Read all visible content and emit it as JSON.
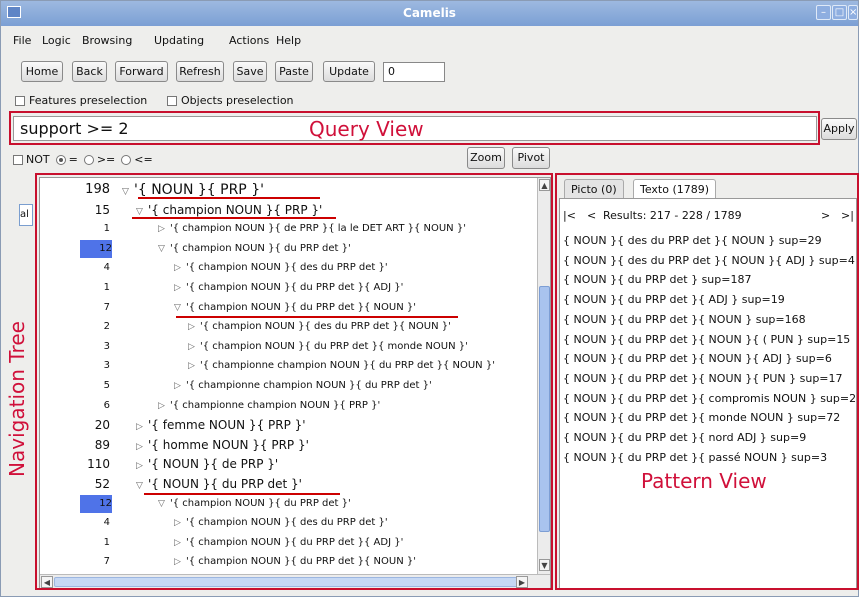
{
  "window": {
    "title": "Camelis"
  },
  "menu": [
    "File",
    "Logic",
    "Browsing",
    "Updating",
    "Actions",
    "Help"
  ],
  "toolbar": {
    "home": "Home",
    "back": "Back",
    "forward": "Forward",
    "refresh": "Refresh",
    "save": "Save",
    "paste": "Paste",
    "update": "Update",
    "count_value": "0"
  },
  "checks": {
    "features": "Features preselection",
    "objects": "Objects preselection"
  },
  "query": {
    "value": "support >= 2",
    "apply": "Apply"
  },
  "ops": {
    "not": "NOT",
    "eq": "=",
    "ge": ">=",
    "le": "<=",
    "zoom": "Zoom",
    "pivot": "Pivot"
  },
  "left_tab": "al",
  "tree": [
    {
      "num": "198",
      "text": "'{ NOUN }{ PRP }'",
      "level": 0,
      "open": true,
      "highlight": false
    },
    {
      "num": "15",
      "text": "'{ champion NOUN }{ PRP }'",
      "level": 1,
      "open": true,
      "highlight": false
    },
    {
      "num": "1",
      "text": "'{ champion NOUN }{ de PRP }{ la le DET ART }{ NOUN }'",
      "level": 2,
      "open": false,
      "highlight": false
    },
    {
      "num": "12",
      "text": "'{ champion NOUN }{ du PRP det }'",
      "level": 2,
      "open": true,
      "highlight": true
    },
    {
      "num": "4",
      "text": "'{ champion NOUN }{ des du PRP det }'",
      "level": 3,
      "open": false,
      "highlight": false
    },
    {
      "num": "1",
      "text": "'{ champion NOUN }{ du PRP det }{ ADJ }'",
      "level": 3,
      "open": false,
      "highlight": false
    },
    {
      "num": "7",
      "text": "'{ champion NOUN }{ du PRP det }{ NOUN }'",
      "level": 3,
      "open": true,
      "highlight": false
    },
    {
      "num": "2",
      "text": "'{ champion NOUN }{ des du PRP det }{ NOUN }'",
      "level": 4,
      "open": false,
      "highlight": false
    },
    {
      "num": "3",
      "text": "'{ champion NOUN }{ du PRP det }{ monde NOUN }'",
      "level": 4,
      "open": false,
      "highlight": false
    },
    {
      "num": "3",
      "text": "'{ championne champion NOUN }{ du PRP det }{ NOUN }'",
      "level": 4,
      "open": false,
      "highlight": false
    },
    {
      "num": "5",
      "text": "'{ championne champion NOUN }{ du PRP det }'",
      "level": 3,
      "open": false,
      "highlight": false
    },
    {
      "num": "6",
      "text": "'{ championne champion NOUN }{ PRP }'",
      "level": 2,
      "open": false,
      "highlight": false
    },
    {
      "num": "20",
      "text": "'{ femme NOUN }{ PRP }'",
      "level": 1,
      "open": false,
      "highlight": false
    },
    {
      "num": "89",
      "text": "'{ homme NOUN }{ PRP }'",
      "level": 1,
      "open": false,
      "highlight": false
    },
    {
      "num": "110",
      "text": "'{ NOUN }{ de PRP }'",
      "level": 1,
      "open": false,
      "highlight": false
    },
    {
      "num": "52",
      "text": "'{ NOUN }{ du PRP det }'",
      "level": 1,
      "open": true,
      "highlight": false
    },
    {
      "num": "12",
      "text": "'{ champion NOUN }{ du PRP det }'",
      "level": 2,
      "open": true,
      "highlight": true
    },
    {
      "num": "4",
      "text": "'{ champion NOUN }{ des du PRP det }'",
      "level": 3,
      "open": false,
      "highlight": false
    },
    {
      "num": "1",
      "text": "'{ champion NOUN }{ du PRP det }{ ADJ }'",
      "level": 3,
      "open": false,
      "highlight": false
    },
    {
      "num": "7",
      "text": "'{ champion NOUN }{ du PRP det }{ NOUN }'",
      "level": 3,
      "open": false,
      "highlight": false
    }
  ],
  "tabs": {
    "picto": "Picto (0)",
    "texto": "Texto (1789)"
  },
  "results_nav": {
    "first": "|<",
    "prev": "<",
    "label": "Results: 217 - 228 / 1789",
    "next": ">",
    "last": ">|"
  },
  "results": [
    "{ NOUN }{ des du PRP det }{ NOUN } sup=29",
    "{ NOUN }{ des du PRP det }{ NOUN }{ ADJ } sup=4",
    "{ NOUN }{ du PRP det } sup=187",
    "{ NOUN }{ du PRP det }{ ADJ } sup=19",
    "{ NOUN }{ du PRP det }{ NOUN } sup=168",
    "{ NOUN }{ du PRP det }{ NOUN }{ ( PUN } sup=15",
    "{ NOUN }{ du PRP det }{ NOUN }{ ADJ } sup=6",
    "{ NOUN }{ du PRP det }{ NOUN }{ PUN } sup=17",
    "{ NOUN }{ du PRP det }{ compromis NOUN } sup=2",
    "{ NOUN }{ du PRP det }{ monde NOUN } sup=72",
    "{ NOUN }{ du PRP det }{ nord ADJ } sup=9",
    "{ NOUN }{ du PRP det }{ passé NOUN } sup=3"
  ],
  "overlays": {
    "query_view": "Query View",
    "navigation_tree": "Navigation Tree",
    "pattern_view": "Pattern View"
  },
  "colors": {
    "annotation": "#d0103a",
    "highlight": "#4f73e8",
    "titlebar": "#7b9fd4"
  }
}
